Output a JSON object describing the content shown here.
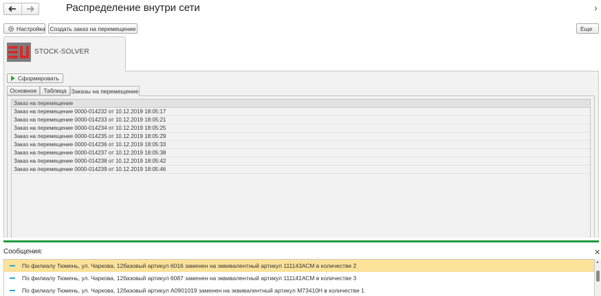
{
  "header": {
    "title": "Распределение внутри сети"
  },
  "toolbar": {
    "settings_label": "Настройка",
    "create_order_label": "Создать заказ на перемещение",
    "more_label": "Еще"
  },
  "report": {
    "logo_text": "STOCK-SOLVER",
    "generate_label": "Сформировать",
    "tabs": [
      {
        "label": "Основное",
        "active": false
      },
      {
        "label": "Таблица",
        "active": false
      },
      {
        "label": "Заказы на перемещение",
        "active": true
      }
    ],
    "table": {
      "header": "Заказ на перемещение",
      "rows": [
        "Заказ на перемещение 0000-014232 от 10.12.2019 18:05:17",
        "Заказ на перемещение 0000-014233 от 10.12.2019 18:05:21",
        "Заказ на перемещение 0000-014234 от 10.12.2019 18:05:25",
        "Заказ на перемещение 0000-014235 от 10.12.2019 18:05:29",
        "Заказ на перемещение 0000-014236 от 10.12.2019 18:05:33",
        "Заказ на перемещение 0000-014237 от 10.12.2019 18:05:38",
        "Заказ на перемещение 0000-014238 от 10.12.2019 18:05:42",
        "Заказ на перемещение 0000-014239 от 10.12.2019 18:05:46"
      ]
    }
  },
  "messages": {
    "title": "Сообщения:",
    "items": [
      "По филиалу Тюмень, ул. Чаркова, 12базовый артикул 6016 заменен на эквивалентный артикул 111143АСМ в количестве 2",
      "По филиалу Тюмень, ул. Чаркова, 12базовый артикул 6087 заменен на эквивалентный артикул 111141АСМ в количестве 3",
      "По филиалу Тюмень, ул. Чаркова, 12базовый артикул A0901019 заменен на эквивалентный артикул M73410H в количестве 1"
    ]
  },
  "icons": {
    "back": "arrow-left-icon",
    "forward": "arrow-right-icon",
    "settings": "gear-icon",
    "dropdown": "caret-down-icon",
    "generate": "play-icon",
    "close": "close-icon"
  },
  "colors": {
    "accent_green": "#1f9a3c",
    "selected_message": "#fbe29a",
    "message_marker": "#2aa4d4",
    "play_icon": "#3ea33e"
  }
}
